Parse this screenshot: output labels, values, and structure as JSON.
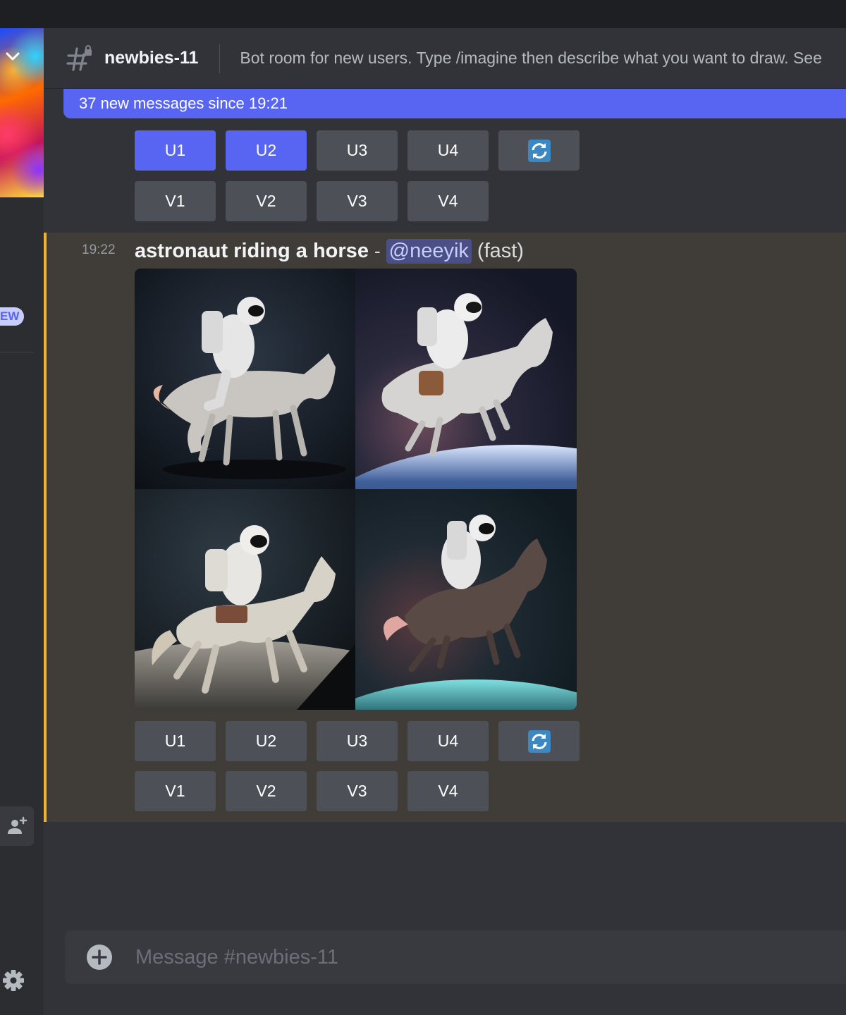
{
  "colors": {
    "blurple": "#5865f2",
    "highlight_border": "#f0b232",
    "highlight_bg": "#403d38",
    "button_gray": "#4e5058"
  },
  "header": {
    "channel_icon": "locked-hashtag-icon",
    "channel_name": "newbies-11",
    "topic": "Bot room for new users. Type /imagine then describe what you want to draw. See"
  },
  "sidebar": {
    "badge": "EW",
    "icons": [
      "chevron-down-icon",
      "add-member-icon",
      "gear-icon"
    ]
  },
  "new_messages_bar": "37 new messages since 19:21",
  "previous_message": {
    "upscale_buttons": [
      "U1",
      "U2",
      "U3",
      "U4"
    ],
    "active_buttons": [
      "U1",
      "U2"
    ],
    "reroll_icon": "refresh-icon",
    "variation_buttons": [
      "V1",
      "V2",
      "V3",
      "V4"
    ]
  },
  "message": {
    "timestamp": "19:22",
    "prompt": "astronaut riding a horse",
    "separator": "-",
    "mention": "@neeyik",
    "speed": "(fast)",
    "upscale_buttons": [
      "U1",
      "U2",
      "U3",
      "U4"
    ],
    "reroll_icon": "refresh-icon",
    "variation_buttons": [
      "V1",
      "V2",
      "V3",
      "V4"
    ]
  },
  "composer": {
    "placeholder": "Message #newbies-11",
    "icon": "add-circle-icon"
  }
}
